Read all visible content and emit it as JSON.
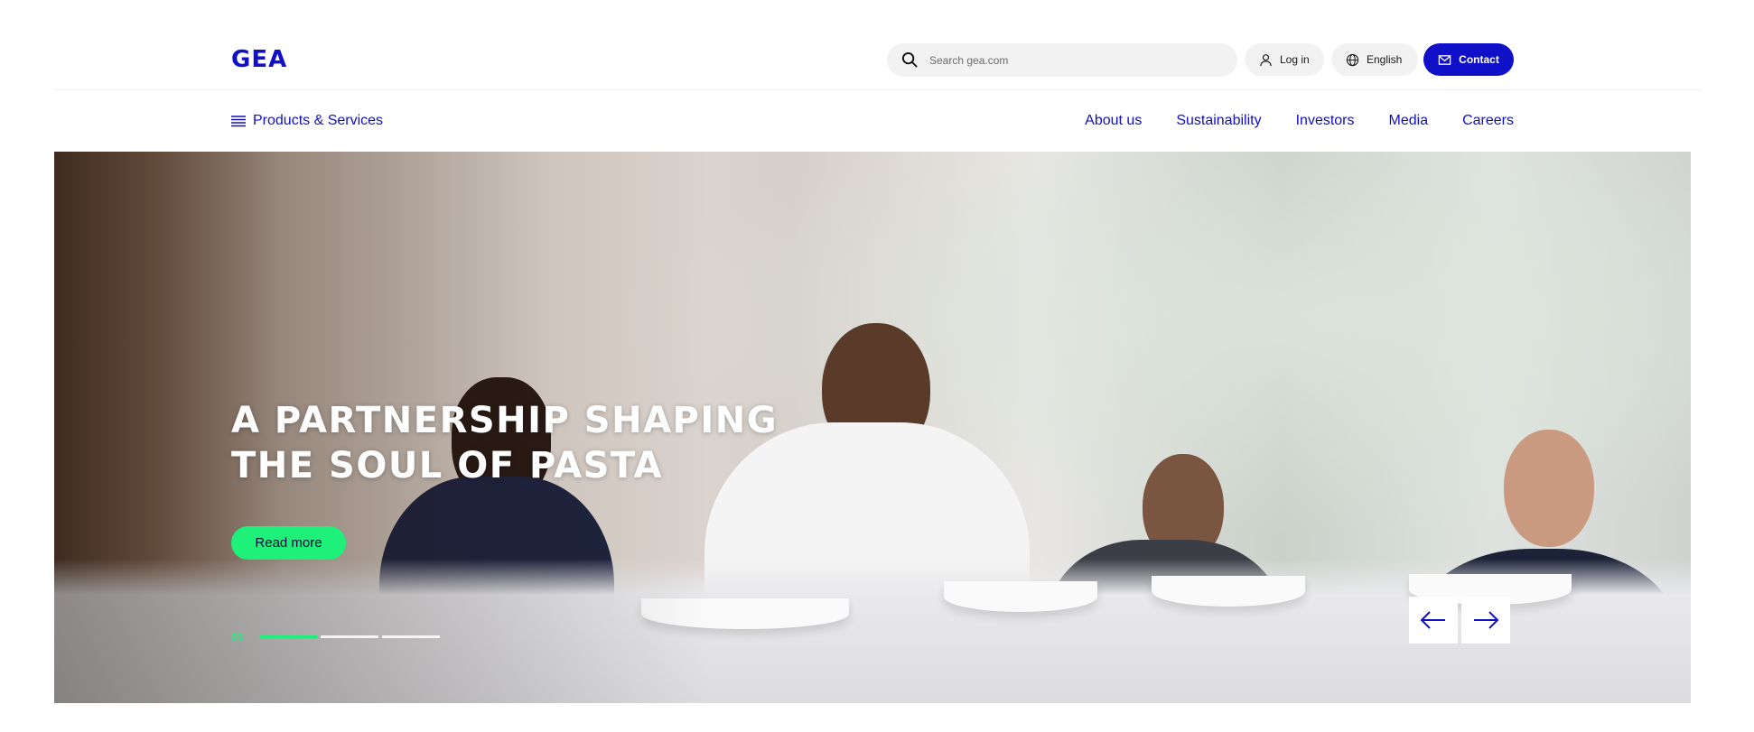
{
  "header": {
    "logo_text": "GEA",
    "search_placeholder": "Search gea.com",
    "login_label": "Log in",
    "language_label": "English",
    "contact_label": "Contact"
  },
  "nav": {
    "products_label": "Products & Services",
    "links": [
      "About us",
      "Sustainability",
      "Investors",
      "Media",
      "Careers"
    ]
  },
  "hero": {
    "headline_line1": "A PARTNERSHIP SHAPING",
    "headline_line2": "THE SOUL OF PASTA",
    "cta_label": "Read more",
    "slide_number": "01",
    "slide_progress": "1/3"
  },
  "icons": {
    "search": "search-icon",
    "user": "user-icon",
    "globe": "globe-icon",
    "mail": "mail-icon",
    "menu": "menu-icon",
    "prev": "arrow-left-icon",
    "next": "arrow-right-icon"
  },
  "colors": {
    "brand": "#1010c8",
    "accent": "#1ef07a",
    "pill_bg": "#f2f2f2"
  }
}
